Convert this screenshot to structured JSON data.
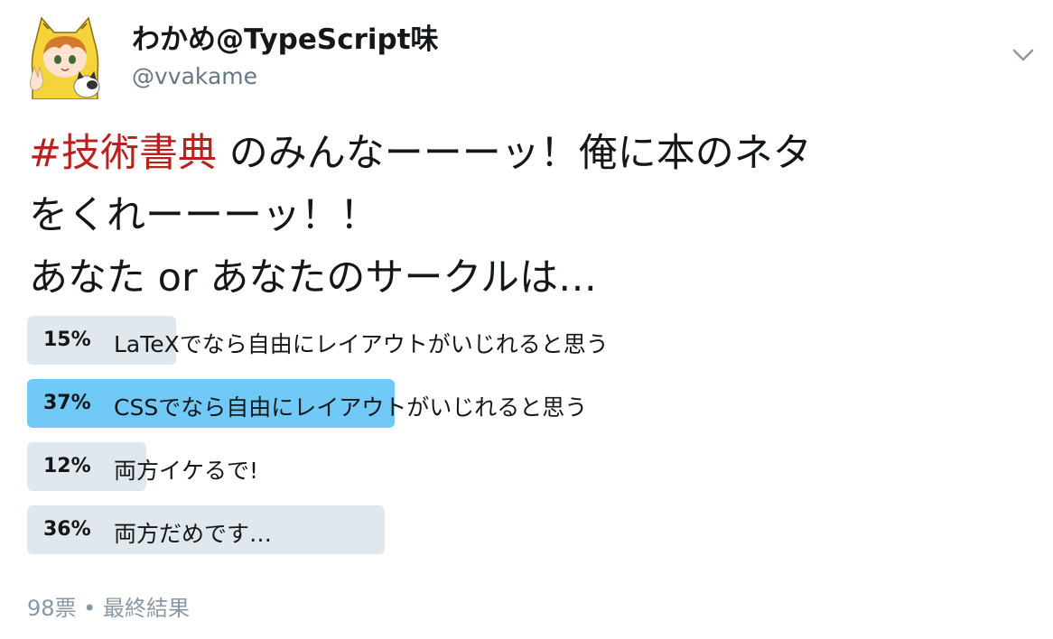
{
  "user": {
    "display_name": "わかめ@TypeScript味",
    "handle": "@vvakame",
    "avatar_icon": "avatar-icon"
  },
  "tweet": {
    "hashtag": "#技術書典",
    "line1_rest": " のみんなーーーッ！俺に本のネタ",
    "line2": "をくれーーーッ！！",
    "line3": "あなた or あなたのサークルは…"
  },
  "poll": {
    "options": [
      {
        "percent_label": "15%",
        "label": "LaTeXでなら自由にレイアウトがいじれると思う",
        "percent": 15,
        "winner": false
      },
      {
        "percent_label": "37%",
        "label": "CSSでなら自由にレイアウトがいじれると思う",
        "percent": 37,
        "winner": true
      },
      {
        "percent_label": "12%",
        "label": "両方イケるで!",
        "percent": 12,
        "winner": false
      },
      {
        "percent_label": "36%",
        "label": "両方だめです…",
        "percent": 36,
        "winner": false
      }
    ],
    "footer": "98票 • 最終結果"
  },
  "colors": {
    "hashtag": "#b8211c",
    "winner_bar": "#71c9f8",
    "bar": "#e1e8ed",
    "secondary_text": "#657786"
  }
}
